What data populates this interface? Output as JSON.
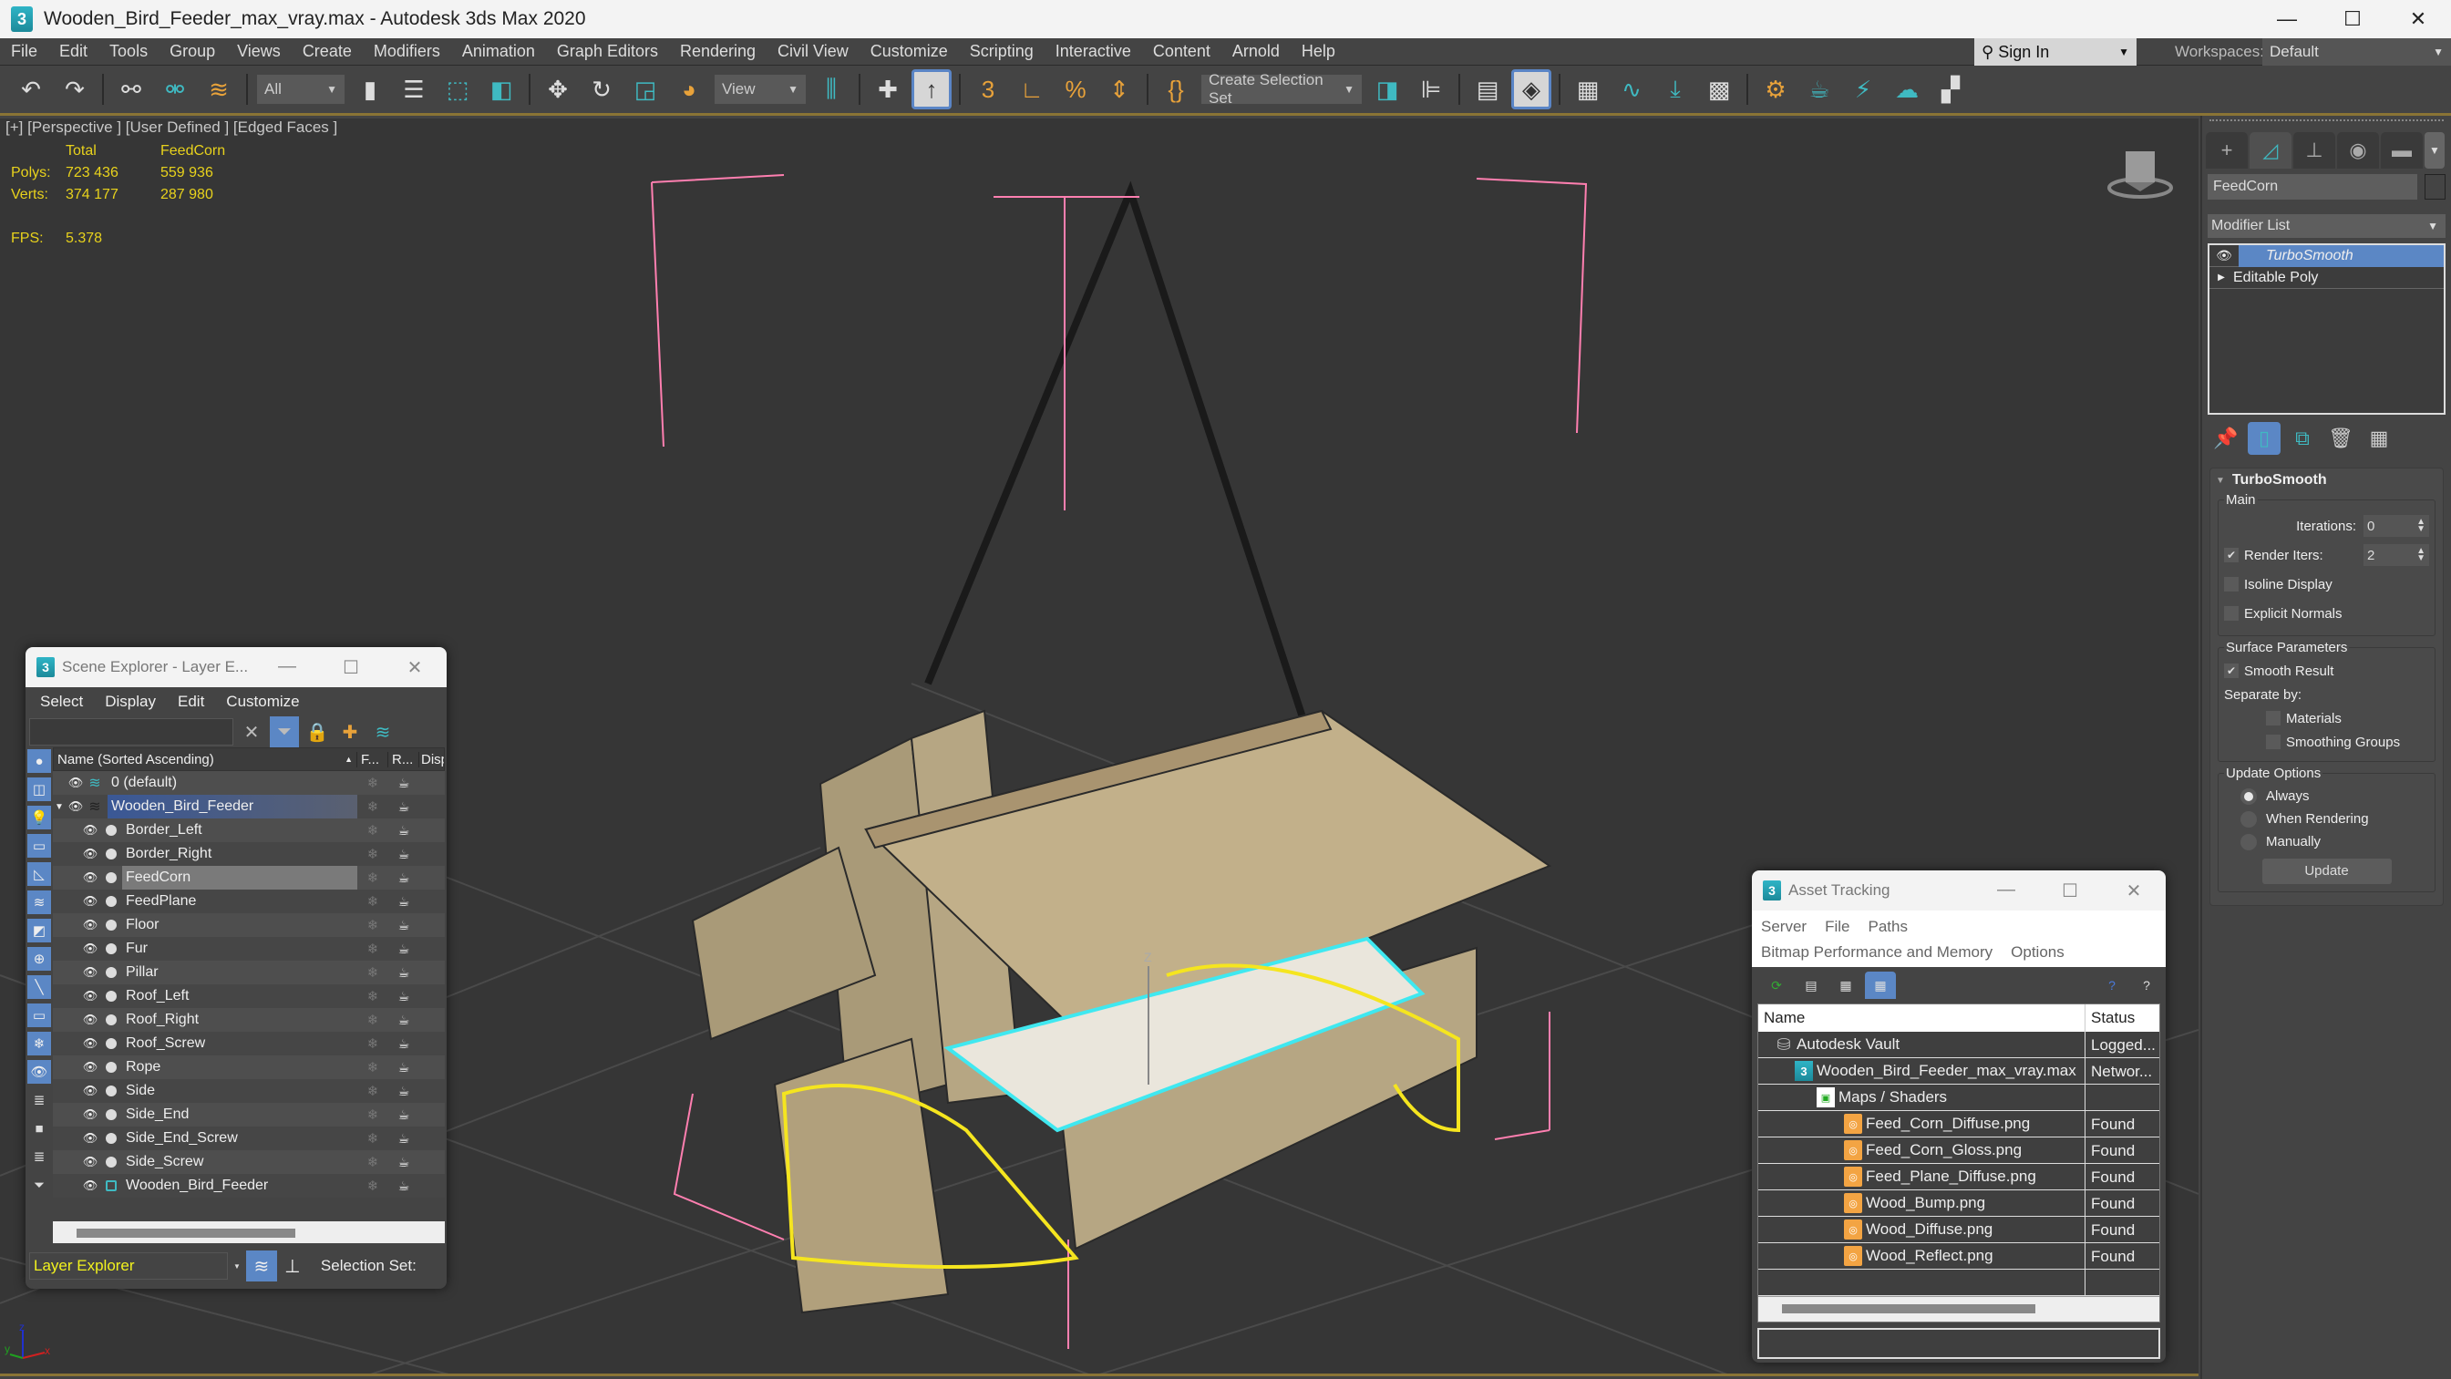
{
  "window": {
    "title": "Wooden_Bird_Feeder_max_vray.max - Autodesk 3ds Max 2020",
    "app_icon_glyph": "3",
    "controls": {
      "minimize": "—",
      "maximize": "☐",
      "close": "✕"
    }
  },
  "menubar": {
    "items": [
      "File",
      "Edit",
      "Tools",
      "Group",
      "Views",
      "Create",
      "Modifiers",
      "Animation",
      "Graph Editors",
      "Rendering",
      "Civil View",
      "Customize",
      "Scripting",
      "Interactive",
      "Content",
      "Arnold",
      "Help"
    ],
    "sign_in": "Sign In",
    "workspaces_label": "Workspaces:",
    "workspace_value": "Default"
  },
  "toolbar": {
    "selection_filter": "All",
    "reference_coord": "View",
    "named_selection_set": "Create Selection Set",
    "icons": [
      "undo-icon",
      "redo-icon",
      "link-icon",
      "unlink-icon",
      "bind-spacewarp-icon",
      "select-object-icon",
      "select-by-name-icon",
      "rect-selection-icon",
      "window-crossing-icon",
      "move-icon",
      "rotate-icon",
      "scale-icon",
      "placement-icon",
      "pivot-icon",
      "select-manipulate-icon",
      "keyboard-shortcut-icon",
      "snap-3d-icon",
      "angle-snap-icon",
      "percent-snap-icon",
      "spinner-snap-icon",
      "edit-named-sets-icon",
      "mirror-icon",
      "align-icon",
      "layer-explorer-icon",
      "scene-explorer-icon",
      "ribbon-icon",
      "curve-editor-icon",
      "schematic-view-icon",
      "material-editor-icon",
      "render-setup-icon",
      "rendered-frame-icon",
      "render-icon",
      "render-cloud-icon",
      "render-activeshade-icon"
    ]
  },
  "viewport": {
    "label": "[+] [Perspective ] [User Defined ] [Edged Faces ]",
    "stats": {
      "col_total": "Total",
      "col_selected": "FeedCorn",
      "polys_label": "Polys:",
      "polys_total": "723 436",
      "polys_selected": "559 936",
      "verts_label": "Verts:",
      "verts_total": "374 177",
      "verts_selected": "287 980",
      "fps_label": "FPS:",
      "fps_value": "5.378"
    },
    "gizmo_axis_label": "Z",
    "tripod": {
      "x": "x",
      "y": "y",
      "z": "z"
    },
    "colors": {
      "stats": "#e8d21c",
      "selection_bbox": "#ff7fb0",
      "selection_outline": "#f5e51f",
      "selected_wire": "#3fe8f0",
      "wood": "#b5a27e"
    }
  },
  "command_panel": {
    "tabs": [
      "create-tab",
      "modify-tab",
      "hierarchy-tab",
      "motion-tab",
      "display-tab",
      "utilities-tab"
    ],
    "object_name": "FeedCorn",
    "modifier_list_label": "Modifier List",
    "stack": [
      {
        "label": "TurboSmooth",
        "selected": true
      },
      {
        "label": "Editable Poly",
        "selected": false
      }
    ],
    "rollout": {
      "title": "TurboSmooth",
      "main_group": "Main",
      "iterations_label": "Iterations:",
      "iterations_value": "0",
      "render_iters_label": "Render Iters:",
      "render_iters_value": "2",
      "render_iters_checked": true,
      "isoline_label": "Isoline Display",
      "isoline_checked": false,
      "explicit_normals_label": "Explicit Normals",
      "explicit_normals_checked": false,
      "surface_group": "Surface Parameters",
      "smooth_result_label": "Smooth Result",
      "smooth_result_checked": true,
      "separate_by_label": "Separate by:",
      "materials_label": "Materials",
      "materials_checked": false,
      "smoothing_groups_label": "Smoothing Groups",
      "smoothing_groups_checked": false,
      "update_group": "Update Options",
      "update_options": [
        "Always",
        "When Rendering",
        "Manually"
      ],
      "update_selected": "Always",
      "update_button": "Update"
    }
  },
  "scene_explorer": {
    "title": "Scene Explorer - Layer E...",
    "menu": [
      "Select",
      "Display",
      "Edit",
      "Customize"
    ],
    "search_placeholder": "",
    "columns": {
      "name": "Name (Sorted Ascending)",
      "sort_indicator": "▲",
      "freeze": "F...",
      "render": "R...",
      "display": "Disp"
    },
    "layers": [
      {
        "name": "0 (default)",
        "selected": false
      },
      {
        "name": "Wooden_Bird_Feeder",
        "selected": true
      }
    ],
    "objects": [
      {
        "name": "Border_Left",
        "selected": false
      },
      {
        "name": "Border_Right",
        "selected": false
      },
      {
        "name": "FeedCorn",
        "selected": true
      },
      {
        "name": "FeedPlane",
        "selected": false
      },
      {
        "name": "Floor",
        "selected": false
      },
      {
        "name": "Fur",
        "selected": false
      },
      {
        "name": "Pillar",
        "selected": false
      },
      {
        "name": "Roof_Left",
        "selected": false
      },
      {
        "name": "Roof_Right",
        "selected": false
      },
      {
        "name": "Roof_Screw",
        "selected": false
      },
      {
        "name": "Rope",
        "selected": false
      },
      {
        "name": "Side",
        "selected": false
      },
      {
        "name": "Side_End",
        "selected": false
      },
      {
        "name": "Side_End_Screw",
        "selected": false
      },
      {
        "name": "Side_Screw",
        "selected": false
      },
      {
        "name": "Wooden_Bird_Feeder",
        "selected": false,
        "is_group": true
      }
    ],
    "mode": "Layer Explorer",
    "selection_set_label": "Selection Set:"
  },
  "asset_tracking": {
    "title": "Asset Tracking",
    "menu_line1": [
      "Server",
      "File",
      "Paths"
    ],
    "menu_line2": [
      "Bitmap Performance and Memory",
      "Options"
    ],
    "columns": {
      "name": "Name",
      "status": "Status"
    },
    "rows": [
      {
        "name": "Autodesk Vault",
        "status": "Logged...",
        "icon": "vault",
        "level": 0
      },
      {
        "name": "Wooden_Bird_Feeder_max_vray.max",
        "status": "Networ...",
        "icon": "max",
        "level": 1
      },
      {
        "name": "Maps / Shaders",
        "status": "",
        "icon": "maps",
        "level": 2
      },
      {
        "name": "Feed_Corn_Diffuse.png",
        "status": "Found",
        "icon": "png",
        "level": 3
      },
      {
        "name": "Feed_Corn_Gloss.png",
        "status": "Found",
        "icon": "png",
        "level": 3
      },
      {
        "name": "Feed_Plane_Diffuse.png",
        "status": "Found",
        "icon": "png",
        "level": 3
      },
      {
        "name": "Wood_Bump.png",
        "status": "Found",
        "icon": "png",
        "level": 3
      },
      {
        "name": "Wood_Diffuse.png",
        "status": "Found",
        "icon": "png",
        "level": 3
      },
      {
        "name": "Wood_Reflect.png",
        "status": "Found",
        "icon": "png",
        "level": 3
      }
    ]
  }
}
